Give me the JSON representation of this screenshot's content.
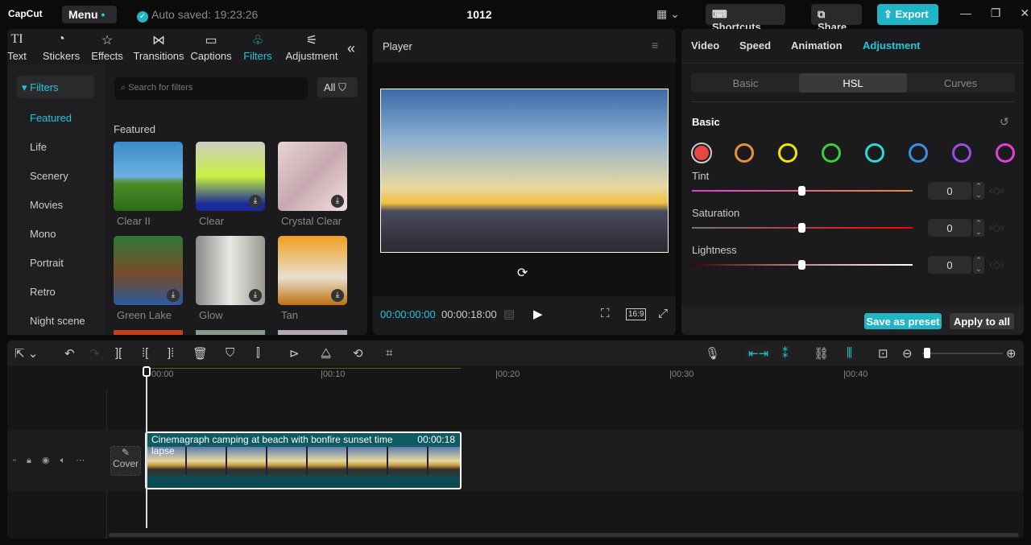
{
  "app": {
    "logo": "CapCut",
    "menu": "Menu",
    "autosave": "Auto saved: 19:23:26",
    "project_title": "1012",
    "shortcuts": "Shortcuts",
    "share": "Share",
    "export": "Export"
  },
  "tabs": [
    {
      "label": "Text",
      "icon": "TI"
    },
    {
      "label": "Stickers",
      "icon": "◔"
    },
    {
      "label": "Effects",
      "icon": "☆"
    },
    {
      "label": "Transitions",
      "icon": "⋈"
    },
    {
      "label": "Captions",
      "icon": "▭"
    },
    {
      "label": "Filters",
      "icon": "♧"
    },
    {
      "label": "Adjustment",
      "icon": "⚟"
    }
  ],
  "sidebar": {
    "header": "▾ Filters",
    "items": [
      "Featured",
      "Life",
      "Scenery",
      "Movies",
      "Mono",
      "Portrait",
      "Retro",
      "Night scene"
    ]
  },
  "search": {
    "placeholder": "Search for filters",
    "all": "All"
  },
  "filters": {
    "section": "Featured",
    "items": [
      "Clear II",
      "Clear",
      "Crystal Clear",
      "Green Lake",
      "Glow",
      "Tan"
    ]
  },
  "player": {
    "title": "Player",
    "current": "00:00:00:00",
    "total": "00:00:18:00",
    "ratio": "16:9"
  },
  "right": {
    "tabs": [
      "Video",
      "Speed",
      "Animation",
      "Adjustment"
    ],
    "subtabs": [
      "Basic",
      "HSL",
      "Curves"
    ],
    "section": "Basic",
    "colors": [
      "#e84545",
      "#e8923a",
      "#f2e600",
      "#3ccf3c",
      "#2fd8d8",
      "#3a8fe0",
      "#9a4de0",
      "#e040d8"
    ],
    "sliders": [
      {
        "label": "Tint",
        "value": "0"
      },
      {
        "label": "Saturation",
        "value": "0"
      },
      {
        "label": "Lightness",
        "value": "0"
      }
    ],
    "save_preset": "Save as preset",
    "apply_all": "Apply to all"
  },
  "timeline": {
    "ticks": [
      "00:00",
      "|00:10",
      "|00:20",
      "|00:30",
      "|00:40"
    ],
    "cover": "Cover",
    "clip_title": "Cinemagraph camping at beach with bonfire sunset time lapse",
    "clip_duration": "00:00:18"
  }
}
